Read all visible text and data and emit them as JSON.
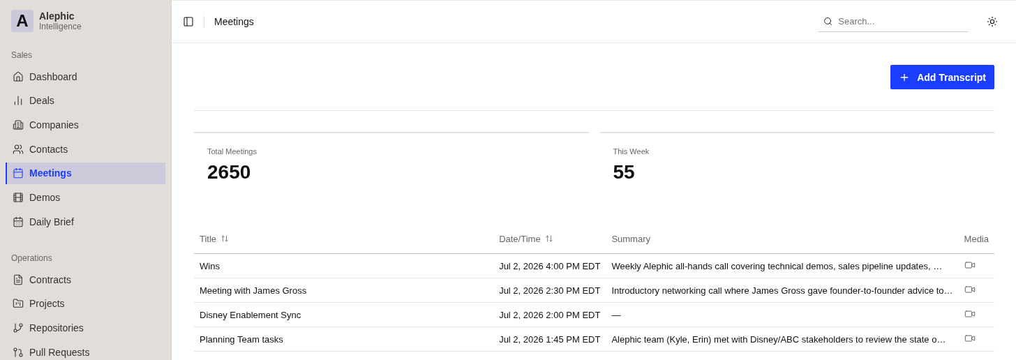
{
  "brand": {
    "name": "Alephic",
    "subtitle": "Intelligence",
    "logo_letter": "A"
  },
  "sidebar": {
    "sections": [
      {
        "title": "Sales",
        "items": [
          {
            "label": "Dashboard",
            "selected": false
          },
          {
            "label": "Deals",
            "selected": false
          },
          {
            "label": "Companies",
            "selected": false
          },
          {
            "label": "Contacts",
            "selected": false
          },
          {
            "label": "Meetings",
            "selected": true
          },
          {
            "label": "Demos",
            "selected": false
          },
          {
            "label": "Daily Brief",
            "selected": false
          }
        ]
      },
      {
        "title": "Operations",
        "items": [
          {
            "label": "Contracts",
            "selected": false
          },
          {
            "label": "Projects",
            "selected": false
          },
          {
            "label": "Repositories",
            "selected": false
          },
          {
            "label": "Pull Requests",
            "selected": false
          }
        ]
      }
    ]
  },
  "header": {
    "title": "Meetings",
    "search": {
      "placeholder": "Search..."
    }
  },
  "add_button": {
    "label": "Add Transcript"
  },
  "stats": [
    {
      "label": "Total Meetings",
      "value": "2650"
    },
    {
      "label": "This Week",
      "value": "55"
    }
  ],
  "table": {
    "columns": [
      {
        "label": "Title",
        "sortable": true
      },
      {
        "label": "Date/Time",
        "sortable": true
      },
      {
        "label": "Summary",
        "sortable": false
      },
      {
        "label": "Media",
        "sortable": false
      }
    ],
    "rows": [
      {
        "title": "Wins",
        "datetime": "Jul 2, 2026 4:00 PM EDT",
        "summary": "Weekly Alephic all-hands call covering technical demos, sales pipeline updates, …"
      },
      {
        "title": "Meeting with James Gross",
        "datetime": "Jul 2, 2026 2:30 PM EDT",
        "summary": "Introductory networking call where James Gross gave founder-to-founder advice to…"
      },
      {
        "title": "Disney Enablement Sync",
        "datetime": "Jul 2, 2026 2:00 PM EDT",
        "summary": "—"
      },
      {
        "title": "Planning Team tasks",
        "datetime": "Jul 2, 2026 1:45 PM EDT",
        "summary": "Alephic team (Kyle, Erin) met with Disney/ABC stakeholders to review the state o…"
      }
    ]
  }
}
